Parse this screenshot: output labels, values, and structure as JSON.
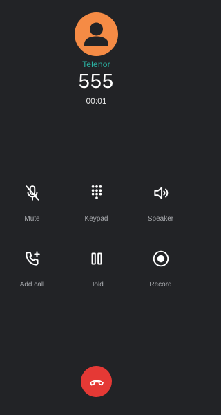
{
  "call": {
    "carrier": "Telenor",
    "number": "555",
    "duration": "00:01"
  },
  "controls": [
    {
      "label": "Mute",
      "icon": "mic-off-icon"
    },
    {
      "label": "Keypad",
      "icon": "dialpad-icon"
    },
    {
      "label": "Speaker",
      "icon": "speaker-icon"
    },
    {
      "label": "Add call",
      "icon": "add-call-icon"
    },
    {
      "label": "Hold",
      "icon": "pause-icon"
    },
    {
      "label": "Record",
      "icon": "record-icon"
    }
  ],
  "end_call": {
    "icon": "hang-up-icon"
  },
  "colors": {
    "background": "#222326",
    "avatar": "#f58b45",
    "carrier_text": "#2bb3a3",
    "end_call": "#e53935"
  }
}
